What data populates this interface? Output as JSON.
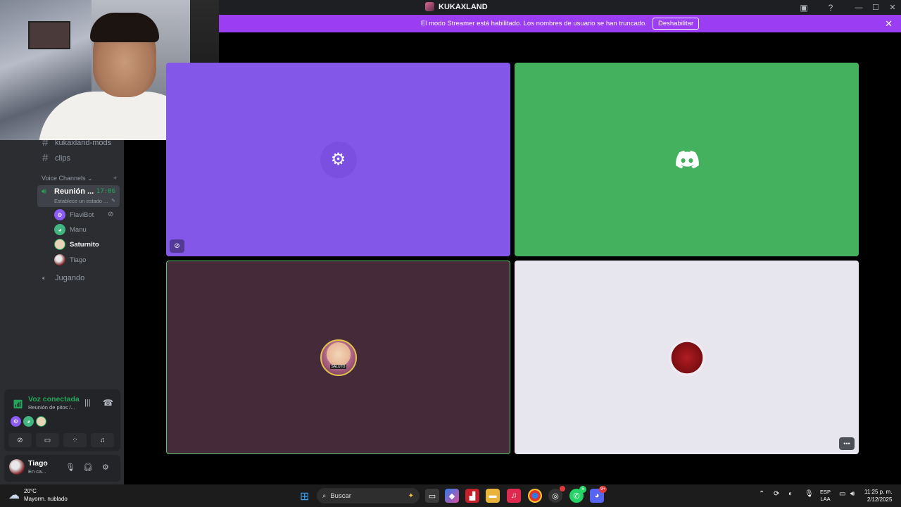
{
  "window": {
    "title": "KUKAXLAND"
  },
  "banner": {
    "text": "El modo Streamer está habilitado. Los nombres de usuario se han truncado.",
    "button": "Deshabilitar"
  },
  "channels": [
    {
      "name": "kukaxland-mods"
    },
    {
      "name": "clips"
    }
  ],
  "voice_header": {
    "label": "Voice Channels",
    "add": "+"
  },
  "active_voice": {
    "name": "Reunión ...",
    "time": "17:06",
    "status": "Establece un estado ..."
  },
  "members": [
    {
      "name": "FlaviBot"
    },
    {
      "name": "Manu"
    },
    {
      "name": "Saturnito"
    },
    {
      "name": "Tiago"
    }
  ],
  "other_voice": {
    "name": "Jugando"
  },
  "voice_panel": {
    "title": "Voz conectada",
    "subtitle": "Reunión de pitos /..."
  },
  "user": {
    "name": "Tiago",
    "status": "En ca..."
  },
  "tiles": {
    "saturnito_badge": "SALUTO"
  },
  "taskbar": {
    "weather_temp": "20°C",
    "weather_desc": "Mayorm. nublado",
    "search_placeholder": "Buscar",
    "lang_top": "ESP",
    "lang_bottom": "LAA",
    "time": "11:25 p. m.",
    "date": "2/12/2025",
    "badges": {
      "whatsapp": "5",
      "discord": "9+"
    }
  },
  "colors": {
    "banner": "#9b3ef3",
    "flavibot_tile": "#8358e8",
    "manu_tile": "#43b15d",
    "saturnito_tile": "#452a3a",
    "tiago_tile": "#e7e6ef",
    "connected": "#23a55a"
  },
  "icons": [
    "discord-logo-icon",
    "signal-icon",
    "hangup-icon",
    "camera-off-icon",
    "screen-share-icon",
    "activities-icon",
    "soundboard-icon",
    "mic-icon",
    "headphones-icon",
    "gear-icon",
    "windows-start-icon",
    "search-icon"
  ]
}
